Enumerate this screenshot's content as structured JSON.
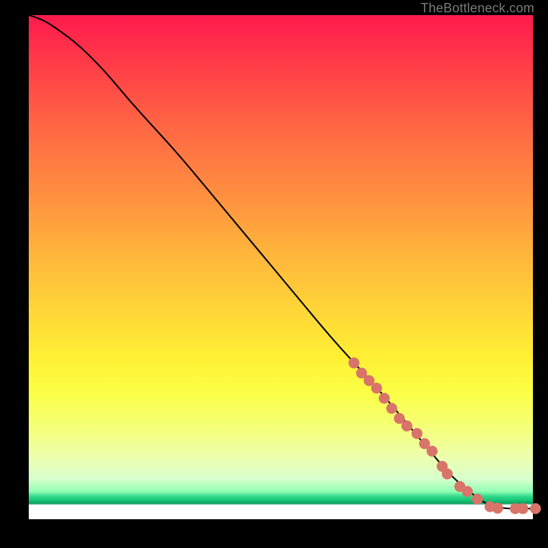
{
  "attribution": "TheBottleneck.com",
  "colors": {
    "curve_stroke": "#000000",
    "marker_fill": "#d87469",
    "background": "#000000"
  },
  "chart_data": {
    "type": "line",
    "title": "",
    "xlabel": "",
    "ylabel": "",
    "xlim": [
      0,
      100
    ],
    "ylim": [
      0,
      100
    ],
    "grid": false,
    "legend": false,
    "series": [
      {
        "name": "curve",
        "x": [
          0,
          3,
          6,
          10,
          15,
          20,
          25,
          30,
          35,
          40,
          45,
          50,
          55,
          60,
          65,
          70,
          75,
          80,
          83,
          85,
          88,
          90,
          92,
          94,
          96,
          98,
          100
        ],
        "y": [
          100,
          99,
          97,
          94,
          89,
          83,
          77.5,
          72,
          66,
          60,
          54,
          48,
          42,
          36,
          30.5,
          25,
          19,
          13,
          9.5,
          7.5,
          5,
          3.5,
          2.5,
          2.2,
          2.1,
          2.1,
          2.1
        ]
      }
    ],
    "markers": [
      {
        "x": 64.5,
        "y": 31.0
      },
      {
        "x": 66.0,
        "y": 29.0
      },
      {
        "x": 67.5,
        "y": 27.5
      },
      {
        "x": 69.0,
        "y": 26.0
      },
      {
        "x": 70.5,
        "y": 24.0
      },
      {
        "x": 72.0,
        "y": 22.0
      },
      {
        "x": 73.5,
        "y": 20.0
      },
      {
        "x": 75.0,
        "y": 18.5
      },
      {
        "x": 77.0,
        "y": 17.0
      },
      {
        "x": 78.5,
        "y": 15.0
      },
      {
        "x": 80.0,
        "y": 13.5
      },
      {
        "x": 82.0,
        "y": 10.5
      },
      {
        "x": 83.0,
        "y": 9.0
      },
      {
        "x": 85.5,
        "y": 6.5
      },
      {
        "x": 87.0,
        "y": 5.5
      },
      {
        "x": 89.0,
        "y": 4.0
      },
      {
        "x": 91.5,
        "y": 2.5
      },
      {
        "x": 93.0,
        "y": 2.2
      },
      {
        "x": 96.5,
        "y": 2.1
      },
      {
        "x": 98.0,
        "y": 2.1
      },
      {
        "x": 100.5,
        "y": 2.1
      }
    ]
  }
}
